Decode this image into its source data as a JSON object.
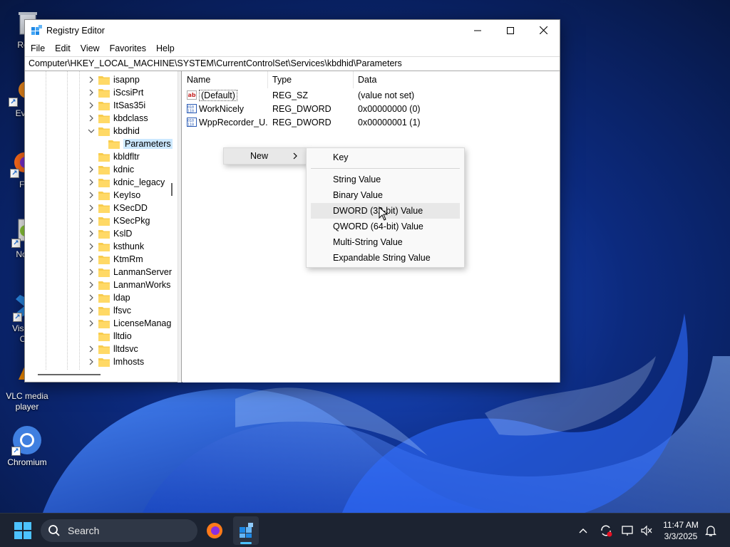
{
  "desktop": {
    "icons": [
      {
        "label": "Recy",
        "icon": "recycle-bin-icon"
      },
      {
        "label": "Ever",
        "icon": "everything-app-icon"
      },
      {
        "label": "Fir",
        "icon": "firefox-icon"
      },
      {
        "label": "Note",
        "icon": "notepad-plus-plus-icon"
      },
      {
        "label": "Visua\nC",
        "icon": "vscode-icon"
      },
      {
        "label": "VLC media\nplayer",
        "icon": "vlc-icon"
      },
      {
        "label": "Chromium",
        "icon": "chromium-icon"
      }
    ]
  },
  "window": {
    "title": "Registry Editor",
    "menu": [
      "File",
      "Edit",
      "View",
      "Favorites",
      "Help"
    ],
    "address": "Computer\\HKEY_LOCAL_MACHINE\\SYSTEM\\CurrentControlSet\\Services\\kbdhid\\Parameters",
    "tree": [
      {
        "label": "isapnp",
        "expander": "collapsed"
      },
      {
        "label": "iScsiPrt",
        "expander": "collapsed"
      },
      {
        "label": "ItSas35i",
        "expander": "collapsed"
      },
      {
        "label": "kbdclass",
        "expander": "collapsed"
      },
      {
        "label": "kbdhid",
        "expander": "expanded"
      },
      {
        "label": "Parameters",
        "expander": "none",
        "selected": true,
        "child": true
      },
      {
        "label": "kbldfltr",
        "expander": "none"
      },
      {
        "label": "kdnic",
        "expander": "collapsed"
      },
      {
        "label": "kdnic_legacy",
        "expander": "collapsed"
      },
      {
        "label": "KeyIso",
        "expander": "collapsed"
      },
      {
        "label": "KSecDD",
        "expander": "collapsed"
      },
      {
        "label": "KSecPkg",
        "expander": "collapsed"
      },
      {
        "label": "KslD",
        "expander": "collapsed"
      },
      {
        "label": "ksthunk",
        "expander": "collapsed"
      },
      {
        "label": "KtmRm",
        "expander": "collapsed"
      },
      {
        "label": "LanmanServer",
        "expander": "collapsed"
      },
      {
        "label": "LanmanWorks",
        "expander": "collapsed"
      },
      {
        "label": "ldap",
        "expander": "collapsed"
      },
      {
        "label": "lfsvc",
        "expander": "collapsed"
      },
      {
        "label": "LicenseManag",
        "expander": "collapsed"
      },
      {
        "label": "lltdio",
        "expander": "none"
      },
      {
        "label": "lltdsvc",
        "expander": "collapsed"
      },
      {
        "label": "lmhosts",
        "expander": "collapsed"
      }
    ],
    "columns": {
      "name": "Name",
      "type": "Type",
      "data": "Data"
    },
    "values": [
      {
        "name": "(Default)",
        "type": "REG_SZ",
        "data": "(value not set)",
        "icon": "string-value-icon",
        "focused": true
      },
      {
        "name": "WorkNicely",
        "type": "REG_DWORD",
        "data": "0x00000000 (0)",
        "icon": "binary-value-icon"
      },
      {
        "name": "WppRecorder_U...",
        "type": "REG_DWORD",
        "data": "0x00000001 (1)",
        "icon": "binary-value-icon"
      }
    ]
  },
  "context_menu": {
    "new_label": "New"
  },
  "submenu": {
    "key_label": "Key",
    "items": [
      "String Value",
      "Binary Value",
      "DWORD (32-bit) Value",
      "QWORD (64-bit) Value",
      "Multi-String Value",
      "Expandable String Value"
    ],
    "hovered_index": 2
  },
  "taskbar": {
    "search_placeholder": "Search",
    "time": "11:47 AM",
    "date": "3/3/2025"
  },
  "colors": {
    "accent": "#0067c0",
    "taskbar": "#1c2331",
    "selection": "#cce8ff"
  }
}
